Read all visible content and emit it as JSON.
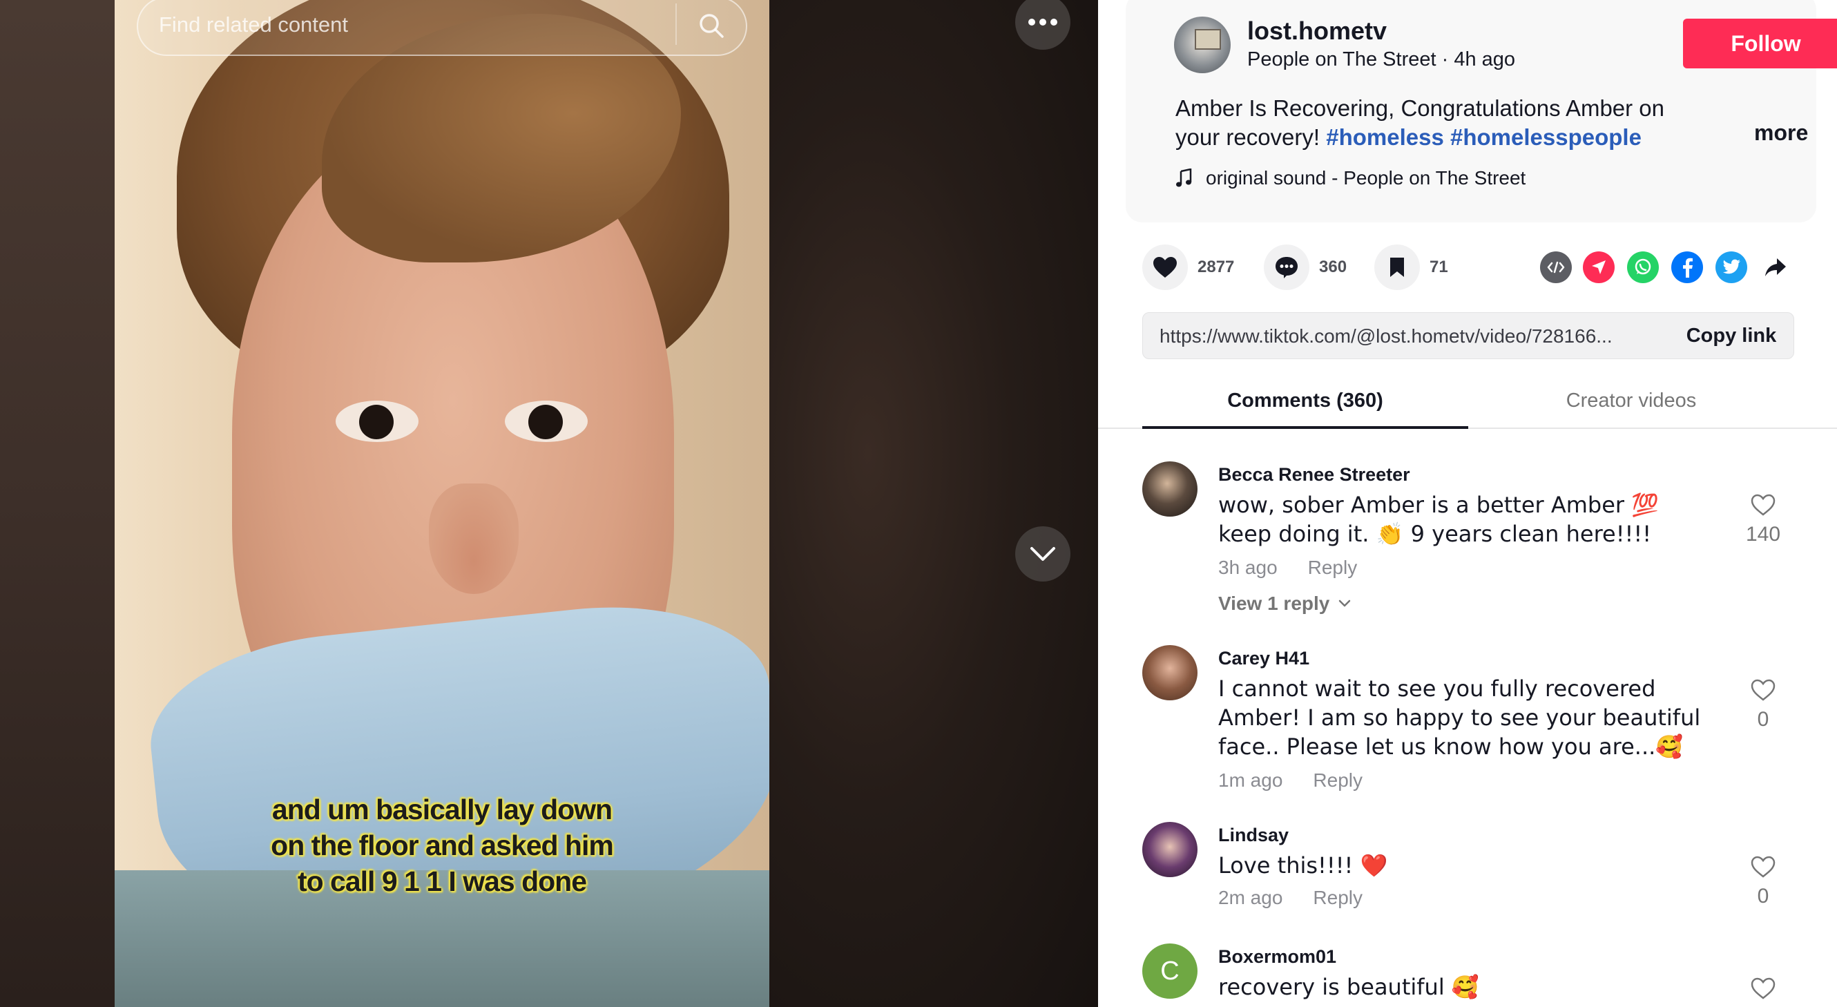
{
  "search": {
    "placeholder": "Find related content"
  },
  "video": {
    "caption_lines": [
      "and um basically lay down",
      "on the floor and asked him",
      "to call 9 1 1 I was done"
    ]
  },
  "author": {
    "username": "lost.hometv",
    "meta": "People on The Street · 4h ago",
    "follow_label": "Follow"
  },
  "description": {
    "text": "Amber Is Recovering, Congratulations Amber on your recovery!",
    "hashtags": [
      "#homeless",
      "#homelesspeople"
    ],
    "more_label": "more"
  },
  "music": {
    "label": "original sound - People on The Street",
    "icon": "music-note-icon"
  },
  "actions": {
    "likes": "2877",
    "comments": "360",
    "saves": "71"
  },
  "share": {
    "icons": [
      "embed-icon",
      "send-icon",
      "whatsapp-icon",
      "facebook-icon",
      "twitter-icon",
      "share-arrow-icon"
    ]
  },
  "link": {
    "url": "https://www.tiktok.com/@lost.hometv/video/728166...",
    "copy_label": "Copy link"
  },
  "tabs": [
    {
      "label": "Comments (360)",
      "active": true
    },
    {
      "label": "Creator videos",
      "active": false
    }
  ],
  "comments": [
    {
      "name": "Becca Renee Streeter",
      "text": "wow, sober Amber is a better Amber 💯 keep doing it. 👏 9 years clean here!!!!",
      "time": "3h ago",
      "reply_label": "Reply",
      "likes": "140",
      "view_replies": "View 1 reply"
    },
    {
      "name": "Carey H41",
      "text": "I cannot wait to see you fully recovered Amber! I am so happy to see your beautiful face.. Please let us know how you are...🥰",
      "time": "1m ago",
      "reply_label": "Reply",
      "likes": "0"
    },
    {
      "name": "Lindsay",
      "text": "Love this!!!! ❤️",
      "time": "2m ago",
      "reply_label": "Reply",
      "likes": "0"
    },
    {
      "name": "Boxermom01",
      "avatar_letter": "C",
      "text": "recovery is beautiful 🥰"
    }
  ],
  "colors": {
    "brand": "#fe2c55",
    "hashtag": "#2b5db9",
    "caption_outline": "#f2e44b"
  }
}
